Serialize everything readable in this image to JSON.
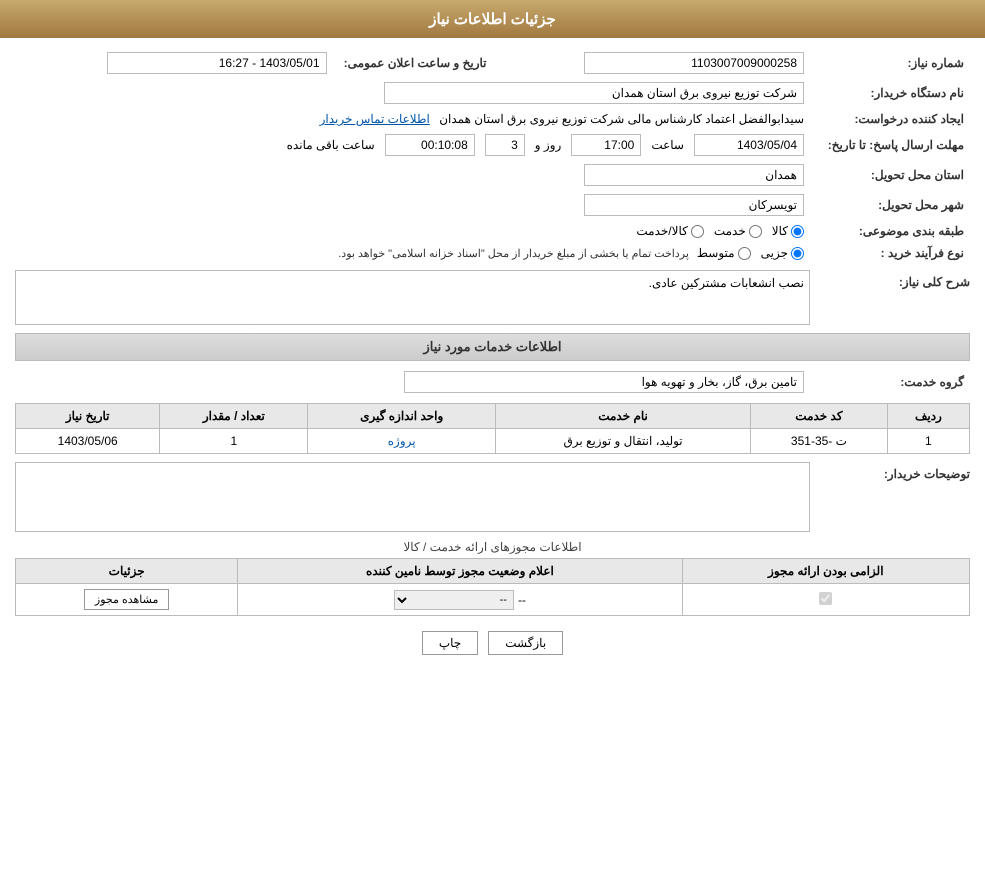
{
  "header": {
    "title": "جزئیات اطلاعات نیاز"
  },
  "fields": {
    "shomara_niaz_label": "شماره نیاز:",
    "shomara_niaz_value": "1103007009000258",
    "nam_dastgah_label": "نام دستگاه خریدار:",
    "nam_dastgah_value": "شرکت توزیع نیروی برق استان همدان",
    "tarikh_label": "تاریخ و ساعت اعلان عمومی:",
    "tarikh_value": "1403/05/01 - 16:27",
    "eijad_label": "ایجاد کننده درخواست:",
    "eijad_value": "سیدابوالفضل اعتماد کارشناس مالی شرکت توزیع نیروی برق استان همدان",
    "eijad_link": "اطلاعات تماس خریدار",
    "mohlet_label": "مهلت ارسال پاسخ: تا تاریخ:",
    "mohlet_date": "1403/05/04",
    "mohlet_saat_label": "ساعت",
    "mohlet_saat": "17:00",
    "mohlet_roz_label": "روز و",
    "mohlet_roz": "3",
    "mohlet_mande_label": "ساعت باقی مانده",
    "mohlet_mande": "00:10:08",
    "ostan_label": "استان محل تحویل:",
    "ostan_value": "همدان",
    "shahr_label": "شهر محل تحویل:",
    "shahr_value": "تویسرکان",
    "tabaqeh_label": "طبقه بندی موضوعی:",
    "tabaqeh_options": [
      "کالا",
      "خدمت",
      "کالا/خدمت"
    ],
    "tabaqeh_selected": "کالا",
    "nooe_farayand_label": "نوع فرآیند خرید :",
    "nooe_farayand_options": [
      "جزیی",
      "متوسط"
    ],
    "nooe_farayand_selected": "جزیی",
    "nooe_farayand_note": "پرداخت تمام یا بخشی از مبلغ خریدار از محل \"اسناد خزانه اسلامی\" خواهد بود.",
    "sharh_label": "شرح کلی نیاز:",
    "sharh_value": "نصب انشعابات مشترکین عادی.",
    "khadamat_section": "اطلاعات خدمات مورد نیاز",
    "gorooh_label": "گروه خدمت:",
    "gorooh_value": "تامین برق، گاز، بخار و تهویه هوا",
    "services_table": {
      "headers": [
        "ردیف",
        "کد خدمت",
        "نام خدمت",
        "واحد اندازه گیری",
        "تعداد / مقدار",
        "تاریخ نیاز"
      ],
      "rows": [
        {
          "radif": "1",
          "kod": "ت -35-351",
          "nam": "تولید، انتقال و توزیع برق",
          "vahed": "پروژه",
          "tedad": "1",
          "tarikh": "1403/05/06"
        }
      ]
    },
    "tosihaat_label": "توضیحات خریدار:",
    "mojoz_section_label": "اطلاعات مجوزهای ارائه خدمت / کالا",
    "mojoz_table": {
      "headers": [
        "الزامی بودن ارائه مجوز",
        "اعلام وضعیت مجوز توسط نامین کننده",
        "جزئیات"
      ],
      "rows": [
        {
          "elzami": true,
          "ealam_value": "--",
          "joziyat_label": "مشاهده مجوز"
        }
      ]
    }
  },
  "buttons": {
    "print_label": "چاپ",
    "back_label": "بازگشت"
  }
}
